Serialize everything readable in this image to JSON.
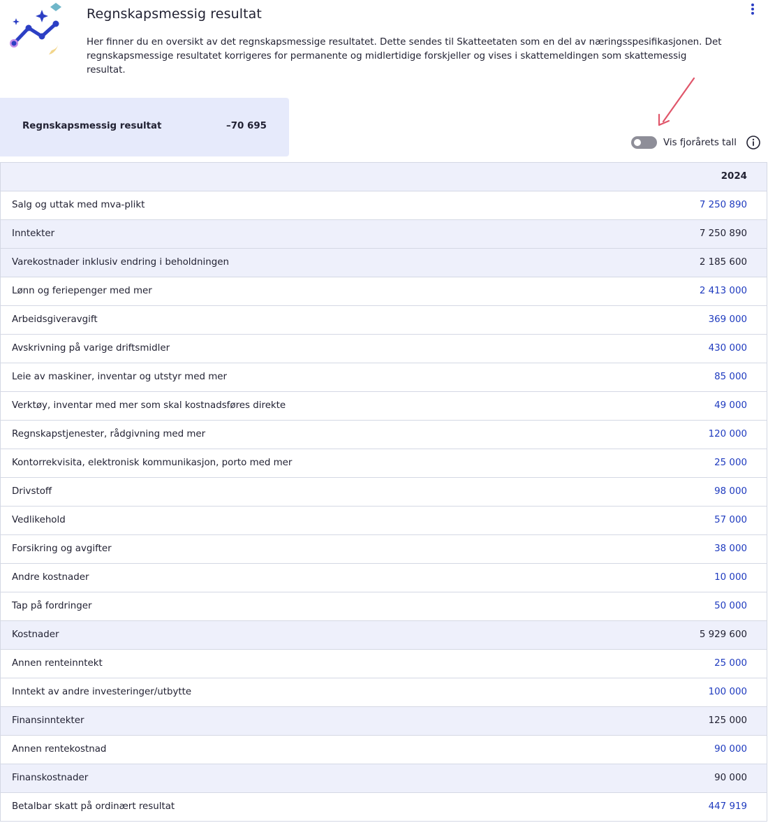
{
  "header": {
    "title": "Regnskapsmessig resultat",
    "intro": "Her finner du en oversikt av det regnskapsmessige resultatet. Dette sendes til Skatteetaten som en del av næringsspesifikasjonen. Det regnskapsmessige resultatet korrigeres for permanente og midlertidige forskjeller og vises i skattemeldingen som skattemessig resultat.",
    "menu_icon": "more-vertical-icon",
    "logo_icon": "chart-sparkle-icon"
  },
  "summary": {
    "label": "Regnskapsmessig resultat",
    "value": "–70 695"
  },
  "toggle": {
    "label": "Vis fjorårets tall",
    "checked": false,
    "info_icon": "info-icon"
  },
  "colors": {
    "accent": "#1f3bbf",
    "summary_bg": "#e6eafb",
    "row_sum_bg": "#eef0fb",
    "annotation_arrow": "#e0566a"
  },
  "table": {
    "year_header": "2024",
    "rows": [
      {
        "label": "Salg og uttak med mva-plikt",
        "value": "7 250 890",
        "sum": false
      },
      {
        "label": "Inntekter",
        "value": "7 250 890",
        "sum": true
      },
      {
        "label": "Varekostnader inklusiv endring i beholdningen",
        "value": "2 185 600",
        "sum": true
      },
      {
        "label": "Lønn og feriepenger med mer",
        "value": "2 413 000",
        "sum": false
      },
      {
        "label": "Arbeidsgiveravgift",
        "value": "369 000",
        "sum": false
      },
      {
        "label": "Avskrivning på varige driftsmidler",
        "value": "430 000",
        "sum": false
      },
      {
        "label": "Leie av maskiner, inventar og utstyr med mer",
        "value": "85 000",
        "sum": false
      },
      {
        "label": "Verktøy, inventar med mer som skal kostnadsføres direkte",
        "value": "49 000",
        "sum": false
      },
      {
        "label": "Regnskapstjenester, rådgivning med mer",
        "value": "120 000",
        "sum": false
      },
      {
        "label": "Kontorrekvisita, elektronisk kommunikasjon, porto med mer",
        "value": "25 000",
        "sum": false
      },
      {
        "label": "Drivstoff",
        "value": "98 000",
        "sum": false
      },
      {
        "label": "Vedlikehold",
        "value": "57 000",
        "sum": false
      },
      {
        "label": "Forsikring og avgifter",
        "value": "38 000",
        "sum": false
      },
      {
        "label": "Andre kostnader",
        "value": "10 000",
        "sum": false
      },
      {
        "label": "Tap på fordringer",
        "value": "50 000",
        "sum": false
      },
      {
        "label": "Kostnader",
        "value": "5 929 600",
        "sum": true
      },
      {
        "label": "Annen renteinntekt",
        "value": "25 000",
        "sum": false
      },
      {
        "label": "Inntekt av andre investeringer/utbytte",
        "value": "100 000",
        "sum": false
      },
      {
        "label": "Finansinntekter",
        "value": "125 000",
        "sum": true
      },
      {
        "label": "Annen rentekostnad",
        "value": "90 000",
        "sum": false
      },
      {
        "label": "Finanskostnader",
        "value": "90 000",
        "sum": true
      },
      {
        "label": "Betalbar skatt på ordinært resultat",
        "value": "447 919",
        "sum": false
      }
    ]
  }
}
